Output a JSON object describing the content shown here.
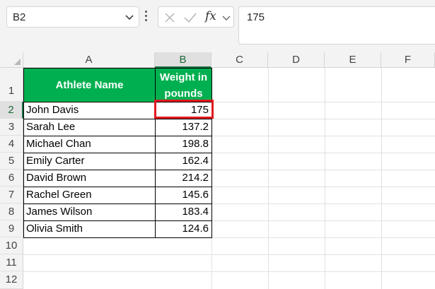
{
  "name_box": {
    "value": "B2"
  },
  "formula_bar": {
    "fx_label": "fx",
    "value": "175"
  },
  "icons": {
    "name_box_dropdown": "chevron-down-icon",
    "more": "more-vertical-icon",
    "cancel": "cancel-x-icon",
    "enter": "check-icon",
    "function": "fx-icon",
    "fx_dropdown": "chevron-down-icon"
  },
  "columns": [
    "A",
    "B",
    "C",
    "D",
    "E",
    "F"
  ],
  "rows": [
    "1",
    "2",
    "3",
    "4",
    "5",
    "6",
    "7",
    "8",
    "9",
    "10",
    "11",
    "12"
  ],
  "table": {
    "headers": {
      "name": "Athlete Name",
      "weight_line1": "Weight in",
      "weight_line2": "pounds"
    },
    "rows": [
      {
        "name": "John Davis",
        "weight": "175"
      },
      {
        "name": "Sarah Lee",
        "weight": "137.2"
      },
      {
        "name": "Michael Chan",
        "weight": "198.8"
      },
      {
        "name": "Emily Carter",
        "weight": "162.4"
      },
      {
        "name": "David Brown",
        "weight": "214.2"
      },
      {
        "name": "Rachel Green",
        "weight": "145.6"
      },
      {
        "name": "James Wilson",
        "weight": "183.4"
      },
      {
        "name": "Olivia Smith",
        "weight": "124.6"
      }
    ]
  },
  "selection": {
    "cell": "B2"
  },
  "colors": {
    "header_fill": "#00b050",
    "header_text": "#ffffff",
    "highlight": "#e0191f",
    "active_header": "#1e7145"
  }
}
